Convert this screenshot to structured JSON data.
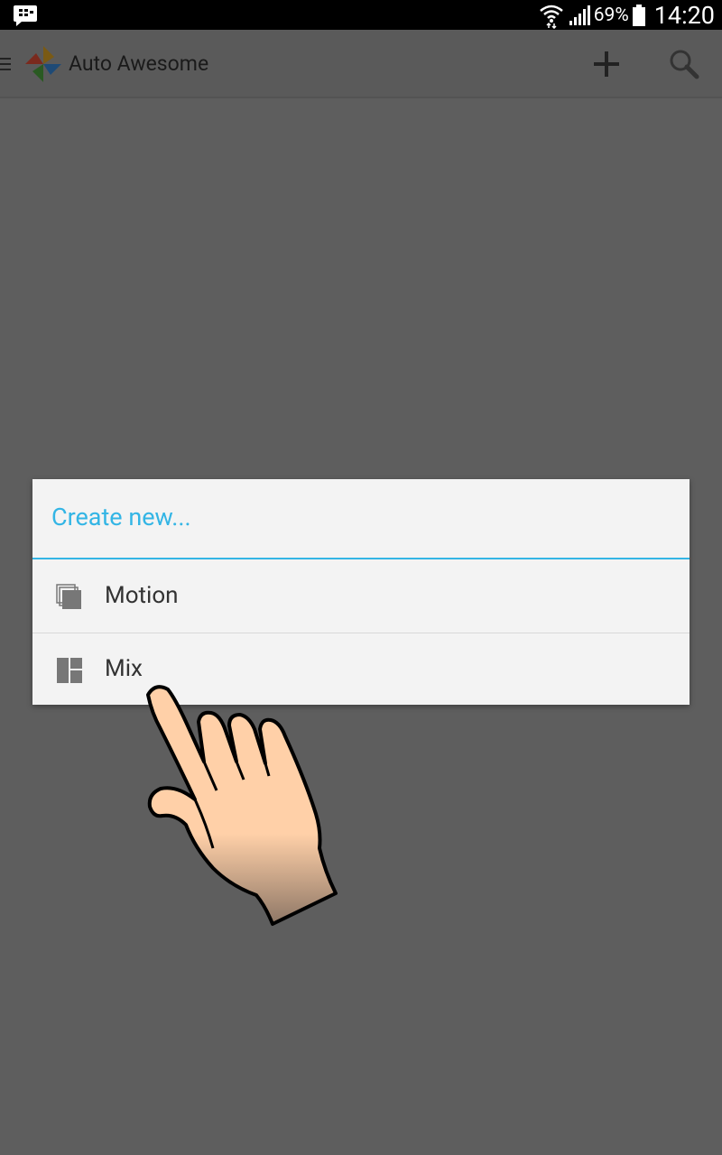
{
  "status_bar": {
    "battery_percent": "69%",
    "time": "14:20"
  },
  "action_bar": {
    "title": "Auto Awesome"
  },
  "dialog": {
    "title": "Create new...",
    "items": [
      {
        "label": "Motion",
        "icon": "motion-icon"
      },
      {
        "label": "Mix",
        "icon": "mix-icon"
      }
    ]
  },
  "colors": {
    "accent": "#33b5e5",
    "scrim": "#5e5e5e",
    "dialog_bg": "#f3f3f3"
  }
}
